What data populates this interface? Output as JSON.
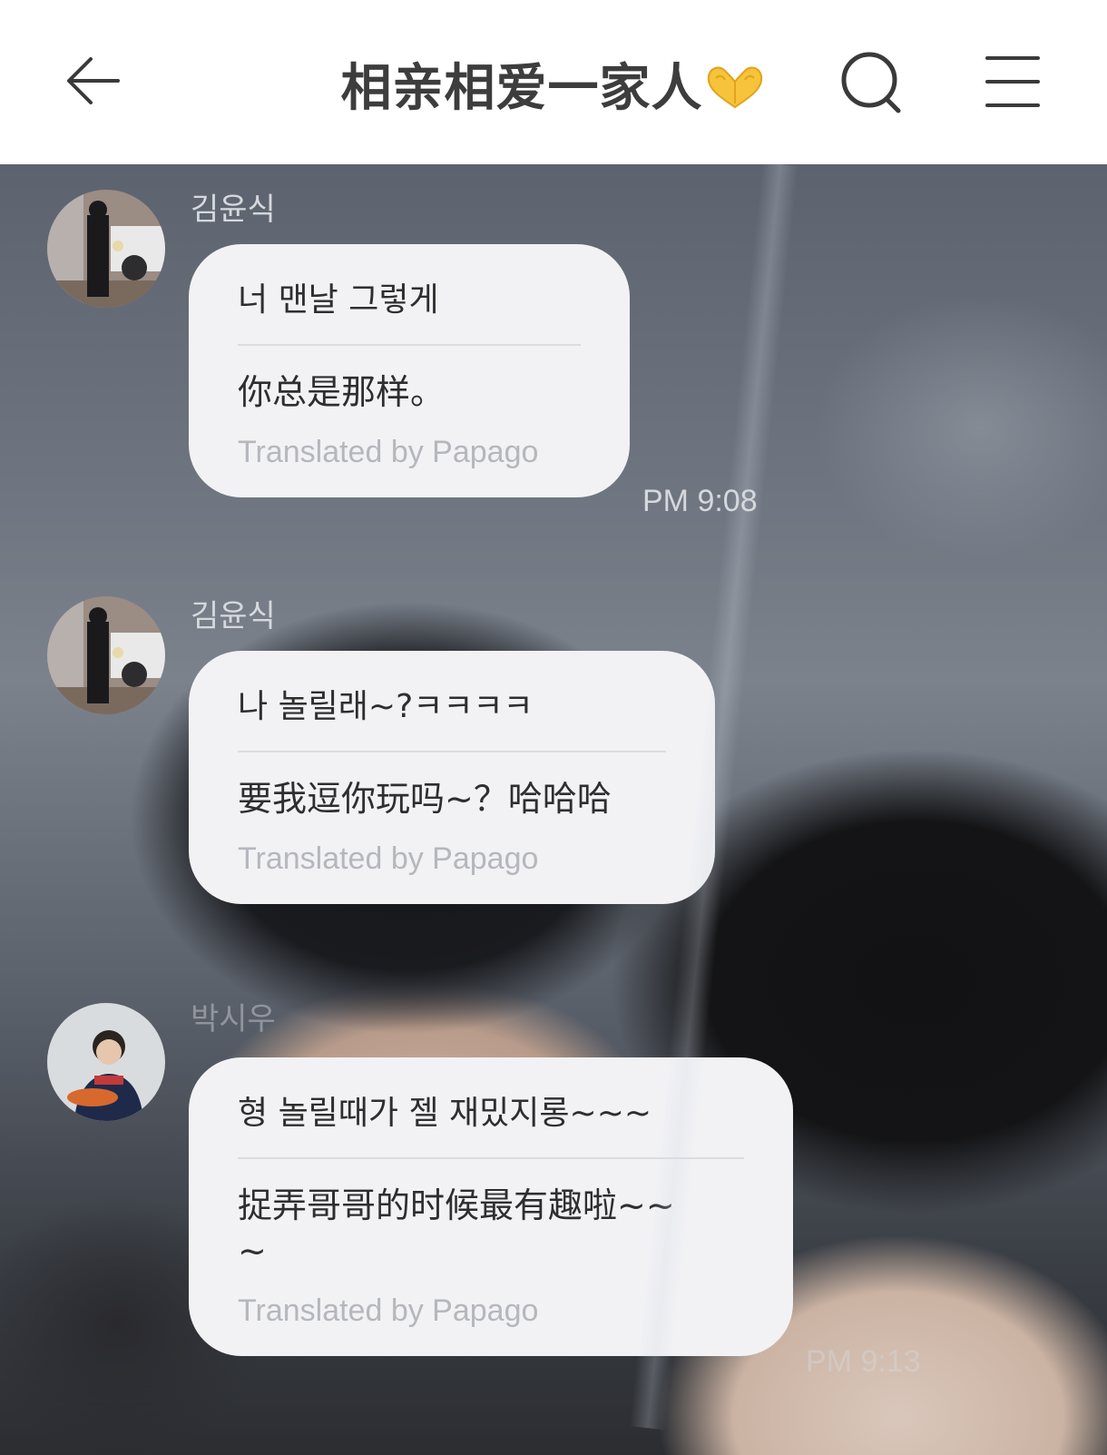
{
  "header": {
    "title": "相亲相爱一家人",
    "icons": [
      "back-arrow-icon",
      "heart-hands-icon",
      "search-icon",
      "menu-icon"
    ]
  },
  "messages": [
    {
      "sender": "김윤식",
      "original": "너 맨날 그렇게",
      "translation": "你总是那样。",
      "credit": "Translated by Papago",
      "time": "PM 9:08"
    },
    {
      "sender": "김윤식",
      "original": "나 놀릴래~?ㅋㅋㅋㅋ",
      "translation": "要我逗你玩吗~？哈哈哈",
      "credit": "Translated by Papago",
      "time": ""
    },
    {
      "sender": "박시우",
      "original": "형 놀릴때가 젤 재밌지롱~~~",
      "translation": "捉弄哥哥的时候最有趣啦~~~",
      "credit": "Translated by Papago",
      "time": "PM 9:13"
    }
  ],
  "colors": {
    "header_bg": "#ffffff",
    "title": "#3d3d3d",
    "bubble_bg": "#f2f2f5",
    "credit_text": "#b5b7bd",
    "sender_text": "#d6d8dc"
  }
}
